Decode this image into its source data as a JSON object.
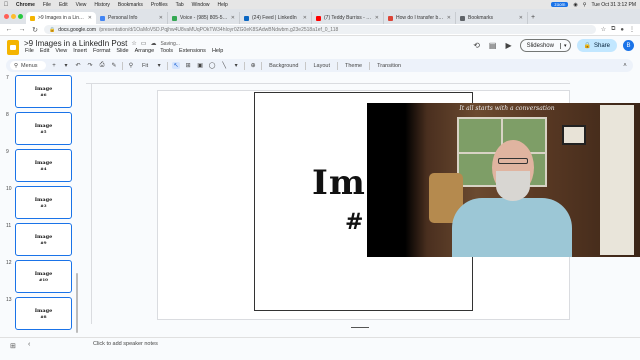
{
  "mac_menu": {
    "apple_icon": "apple-icon",
    "items": [
      "Chrome",
      "File",
      "Edit",
      "View",
      "History",
      "Bookmarks",
      "Profiles",
      "Tab",
      "Window",
      "Help"
    ],
    "zoom_badge": "zoom",
    "clock": "Tue Oct 31 3:12 PM"
  },
  "tabs": [
    {
      "title": ">9 Images in a LinkedIn P",
      "color": "#f4b400",
      "active": true
    },
    {
      "title": "Personal Info",
      "color": "#4285f4",
      "active": false
    },
    {
      "title": "Voice - (985) 805-5389",
      "color": "#34a853",
      "active": false
    },
    {
      "title": "(24) Feed | LinkedIn",
      "color": "#0a66c2",
      "active": false
    },
    {
      "title": "(7) Teddy Burriss - YouTu",
      "color": "#ff0000",
      "active": false
    },
    {
      "title": "How do I transfer bookm",
      "color": "#db4437",
      "active": false
    },
    {
      "title": "Bookmarks",
      "color": "#5f6368",
      "active": false
    }
  ],
  "address": {
    "host": "docs.google.com",
    "path": "/presentation/d/1OaMoV5D.Pqjhw4U8vaMUqPOkTW34hIoyr0ZG0eK8SAdwBNdwbm.g23e2518a1ef_0_118"
  },
  "header": {
    "doc_title": ">9 Images in a LinkedIn Post",
    "saving": "Saving...",
    "menu": [
      "File",
      "Edit",
      "View",
      "Insert",
      "Format",
      "Slide",
      "Arrange",
      "Tools",
      "Extensions",
      "Help"
    ],
    "slideshow_label": "Slideshow",
    "share_label": "Share",
    "avatar_letter": "B"
  },
  "toolbar": {
    "menus_label": "Menus",
    "zoom_label": "Fit",
    "background_label": "Background",
    "layout_label": "Layout",
    "theme_label": "Theme",
    "transition_label": "Transition"
  },
  "slides": [
    {
      "num": "7",
      "line1": "Image",
      "line2": "#6"
    },
    {
      "num": "8",
      "line1": "Image",
      "line2": "#5"
    },
    {
      "num": "9",
      "line1": "Image",
      "line2": "#4"
    },
    {
      "num": "10",
      "line1": "Image",
      "line2": "#3"
    },
    {
      "num": "11",
      "line1": "Image",
      "line2": "#9"
    },
    {
      "num": "12",
      "line1": "Image",
      "line2": "#10"
    },
    {
      "num": "13",
      "line1": "Image",
      "line2": "#8"
    }
  ],
  "canvas": {
    "title": "Ima",
    "subtitle": "#"
  },
  "webcam": {
    "quote": "It all starts with a conversation"
  },
  "notes": {
    "placeholder": "Click to add speaker notes"
  }
}
